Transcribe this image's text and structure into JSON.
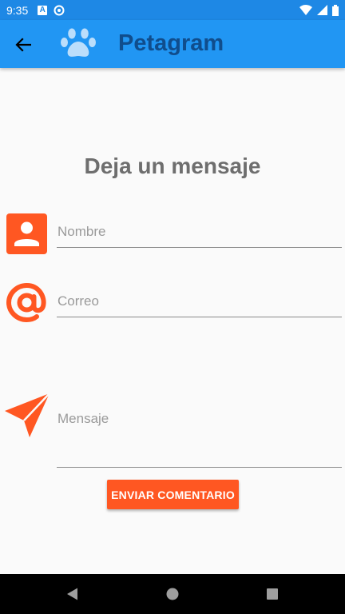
{
  "status_bar": {
    "time": "9:35",
    "left_icons": [
      "a-icon",
      "sync-icon"
    ],
    "right_icons": [
      "wifi-icon",
      "signal-icon",
      "battery-icon"
    ]
  },
  "app_bar": {
    "title": "Petagram",
    "back_icon": "arrow-left-icon",
    "logo_icon": "paw-icon",
    "color": "#2196f3",
    "title_color": "#104d8c"
  },
  "form": {
    "heading": "Deja un mensaje",
    "name_placeholder": "Nombre",
    "email_placeholder": "Correo",
    "message_placeholder": "Mensaje",
    "name_value": "",
    "email_value": "",
    "message_value": "",
    "submit_label": "ENVIAR COMENTARIO",
    "accent_color": "#ff5722"
  },
  "nav_bar": {
    "items": [
      "back",
      "home",
      "recents"
    ]
  }
}
